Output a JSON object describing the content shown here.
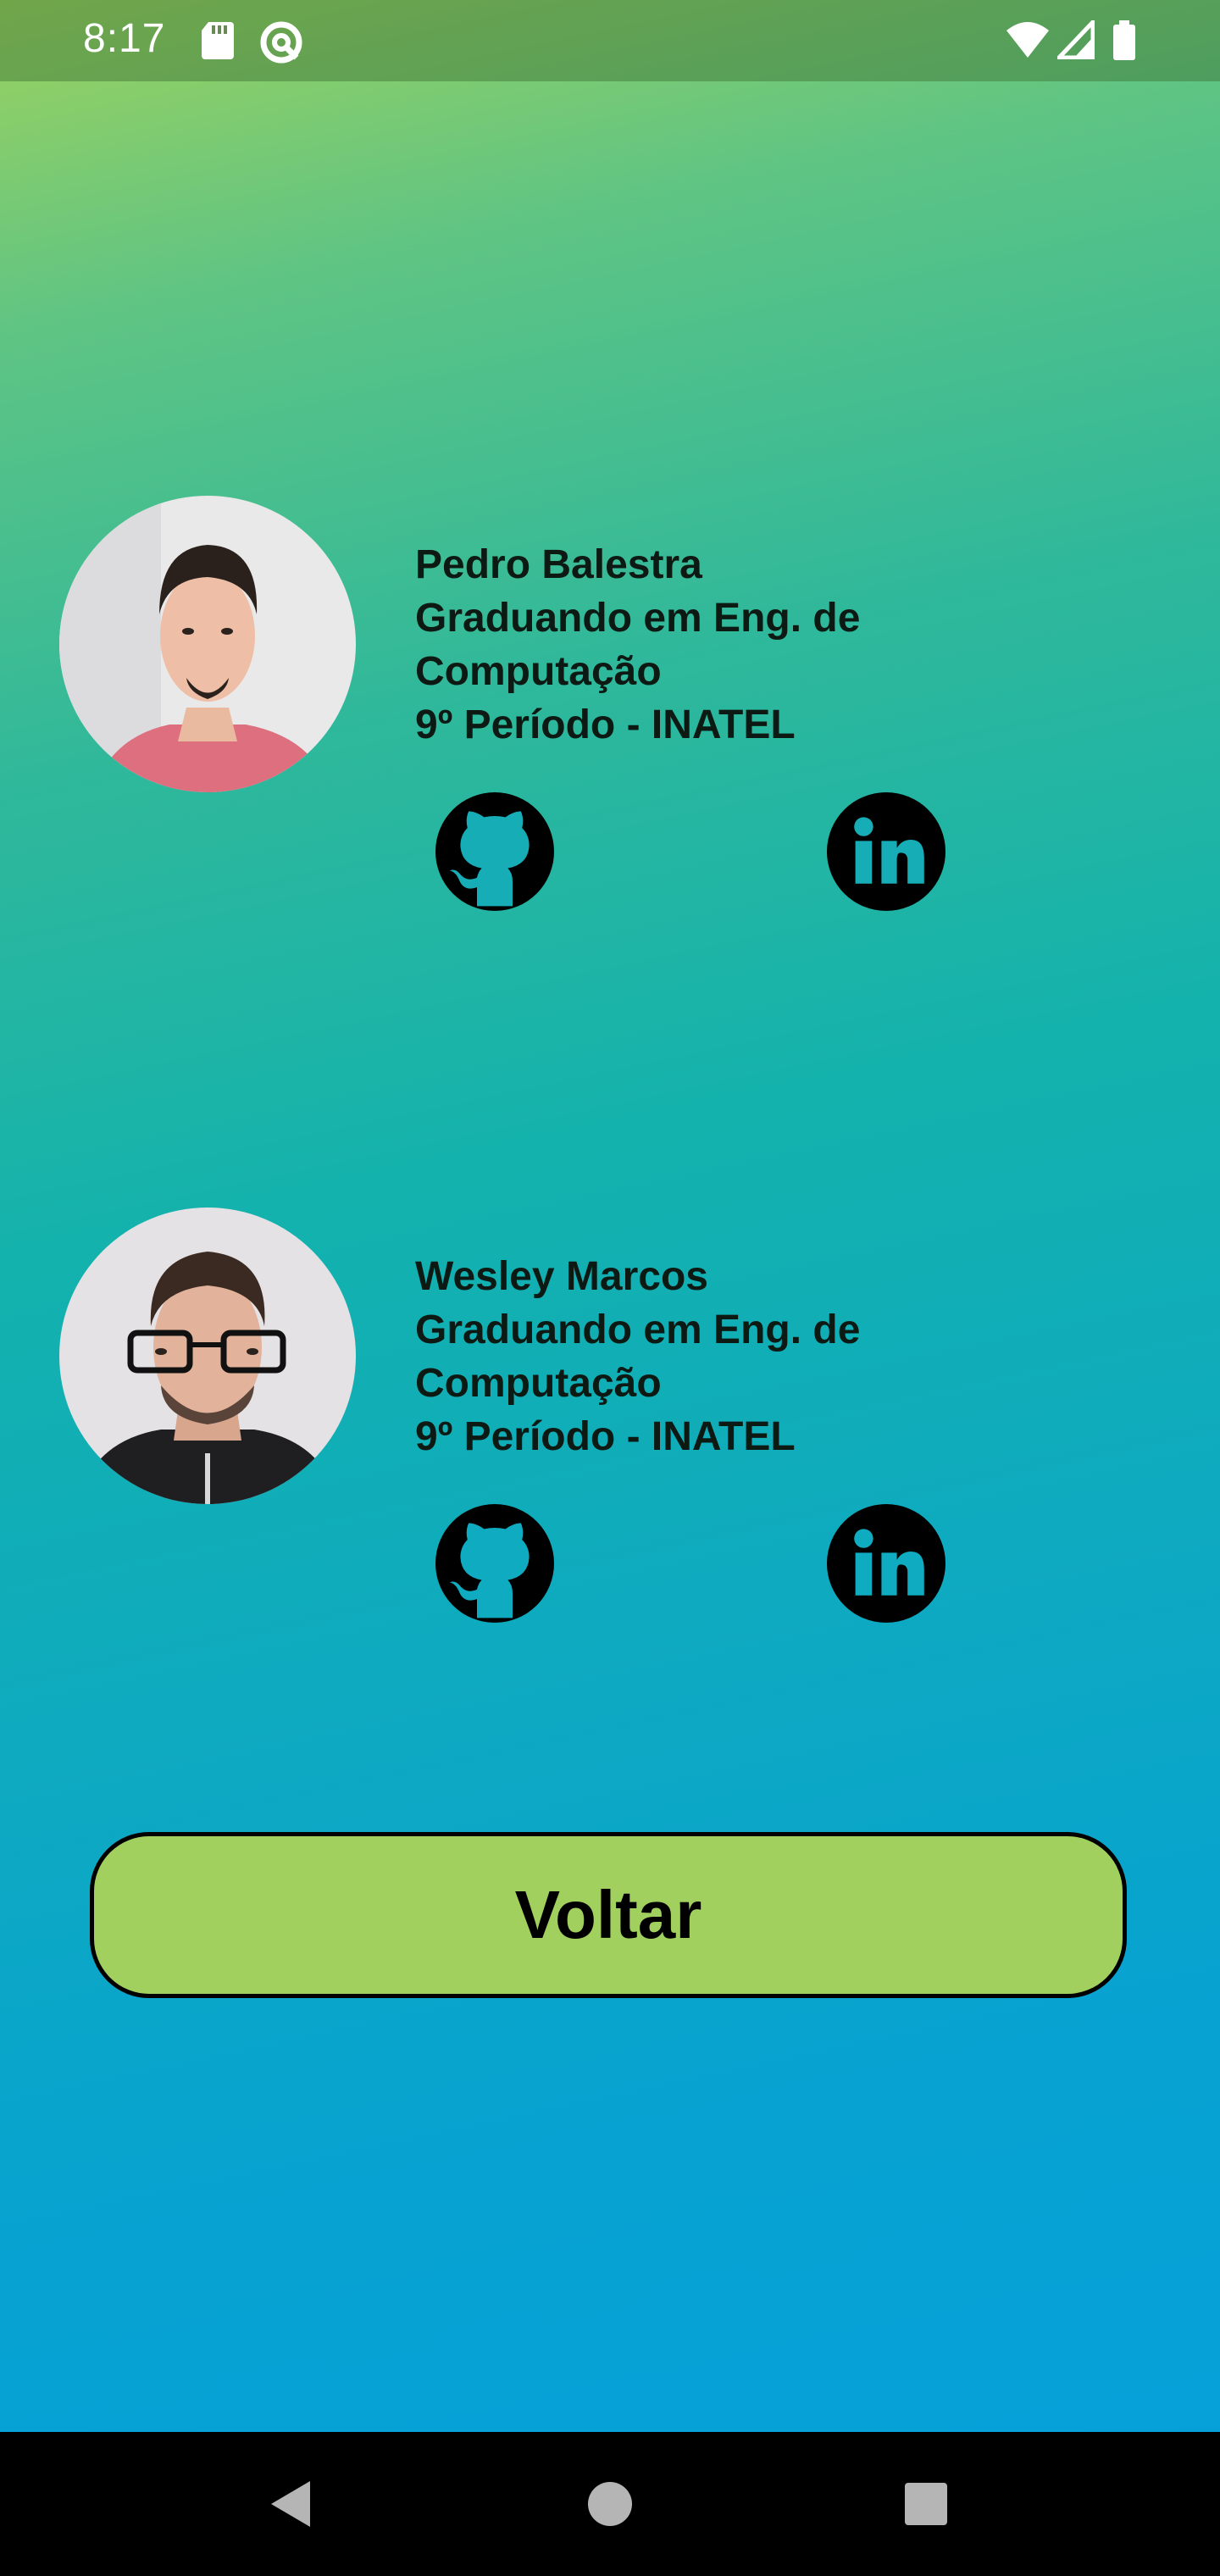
{
  "status_bar": {
    "time": "8:17",
    "icons": [
      "sd-card-icon",
      "vpn-icon",
      "wifi-icon",
      "signal-icon",
      "battery-icon"
    ]
  },
  "profiles": [
    {
      "name": "Pedro Balestra",
      "line2": "Graduando em Eng. de",
      "line3": "Computação",
      "line4": "9º Período - INATEL",
      "links": [
        "github-icon",
        "linkedin-icon"
      ]
    },
    {
      "name": "Wesley Marcos",
      "line2": "Graduando em Eng. de",
      "line3": "Computação",
      "line4": "9º Período - INATEL",
      "links": [
        "github-icon",
        "linkedin-icon"
      ]
    }
  ],
  "back_button": {
    "label": "Voltar"
  },
  "colors": {
    "button_bg": "#a2d05f",
    "gradient_top": "#9dd25e",
    "gradient_bottom": "#05a0db",
    "text": "#0d1a14"
  },
  "nav_bar": {
    "buttons": [
      "back-icon",
      "home-icon",
      "recents-icon"
    ]
  }
}
